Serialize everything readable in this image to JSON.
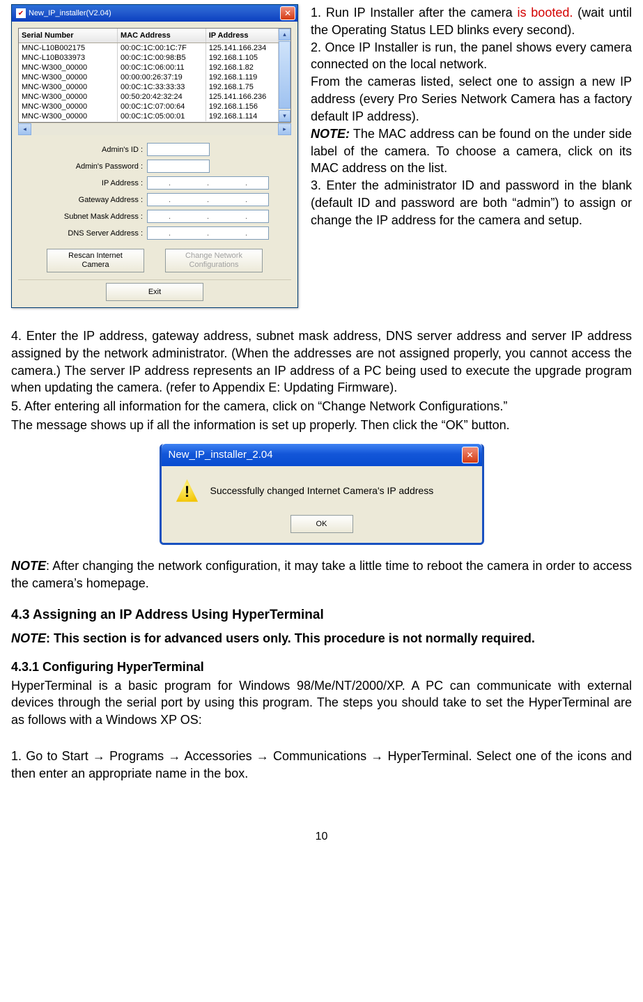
{
  "installer": {
    "title": "New_IP_installer(V2.04)",
    "columns": [
      "Serial Number",
      "MAC Address",
      "IP Address"
    ],
    "rows": [
      {
        "sn": "MNC-L10B002175",
        "mac": "00:0C:1C:00:1C:7F",
        "ip": "125.141.166.234"
      },
      {
        "sn": "MNC-L10B033973",
        "mac": "00:0C:1C:00:98:B5",
        "ip": "192.168.1.105"
      },
      {
        "sn": "MNC-W300_00000",
        "mac": "00:0C:1C:06:00:11",
        "ip": "192.168.1.82"
      },
      {
        "sn": "MNC-W300_00000",
        "mac": "00:00:00:26:37:19",
        "ip": "192.168.1.119"
      },
      {
        "sn": "MNC-W300_00000",
        "mac": "00:0C:1C:33:33:33",
        "ip": "192.168.1.75"
      },
      {
        "sn": "MNC-W300_00000",
        "mac": "00:50:20:42:32:24",
        "ip": "125.141.166.236"
      },
      {
        "sn": "MNC-W300_00000",
        "mac": "00:0C:1C:07:00:64",
        "ip": "192.168.1.156"
      },
      {
        "sn": "MNC-W300_00000",
        "mac": "00:0C:1C:05:00:01",
        "ip": "192.168.1.114"
      }
    ],
    "labels": {
      "admin_id": "Admin's ID :",
      "admin_pw": "Admin's Password :",
      "ip": "IP Address :",
      "gw": "Gateway Address :",
      "sm": "Subnet Mask Address :",
      "dns": "DNS Server Address :"
    },
    "buttons": {
      "rescan": "Rescan Internet\nCamera",
      "change": "Change Network\nConfigurations",
      "exit": "Exit"
    }
  },
  "right": {
    "p1a": "1. Run IP Installer after the camera ",
    "p1b": "is booted.",
    "p1c": " (wait until the Operating Status LED blinks every second).",
    "p2": "2. Once IP Installer is run, the panel shows every camera connected on the local network.",
    "p3": "From the cameras listed, select one to assign a new IP address (every Pro Series Network Camera has a factory default IP address).",
    "note_l": "NOTE:",
    "note_t": " The MAC address can be found on the under side label of the camera. To choose a camera, click on its MAC address on the list.",
    "p4": "3. Enter the administrator ID and password in the blank (default ID and password are both “admin”) to assign or change the IP address for the camera and setup."
  },
  "body": {
    "p4": "4. Enter the IP address, gateway address, subnet mask address, DNS server address and server IP address assigned by the network administrator. (When the addresses are not assigned properly, you cannot access the camera.) The server IP address represents an IP address of a PC being used to execute the upgrade program when updating the camera. (refer to Appendix E: Updating Firmware).",
    "p5": "5. After entering all information for the camera, click on “Change Network Configurations.”",
    "p5b": "The message shows up if all the information is set up properly. Then click the “OK” button.",
    "note2_l": "NOTE",
    "note2_t": ": After changing the network configuration, it may take a little time to reboot the camera in order to access the camera’s homepage.",
    "h43": "4.3 Assigning an IP Address Using HyperTerminal",
    "h43_note_l": "NOTE",
    "h43_note_t": ": This section is for advanced users only. This procedure is not normally required.",
    "h431": "4.3.1 Configuring HyperTerminal",
    "h431_t": "HyperTerminal is a basic program for Windows 98/Me/NT/2000/XP. A PC can communicate with external devices through the serial port by using this program. The steps you should take to set the HyperTerminal are as follows with a Windows XP OS:",
    "step1": "1. Go to Start → Programs → Accessories → Communications → HyperTerminal. Select one of the icons and then enter an appropriate name in the box."
  },
  "dialog": {
    "title": "New_IP_installer_2.04",
    "msg": "Successfully changed Internet Camera's IP address",
    "ok": "OK"
  },
  "pagenum": "10"
}
